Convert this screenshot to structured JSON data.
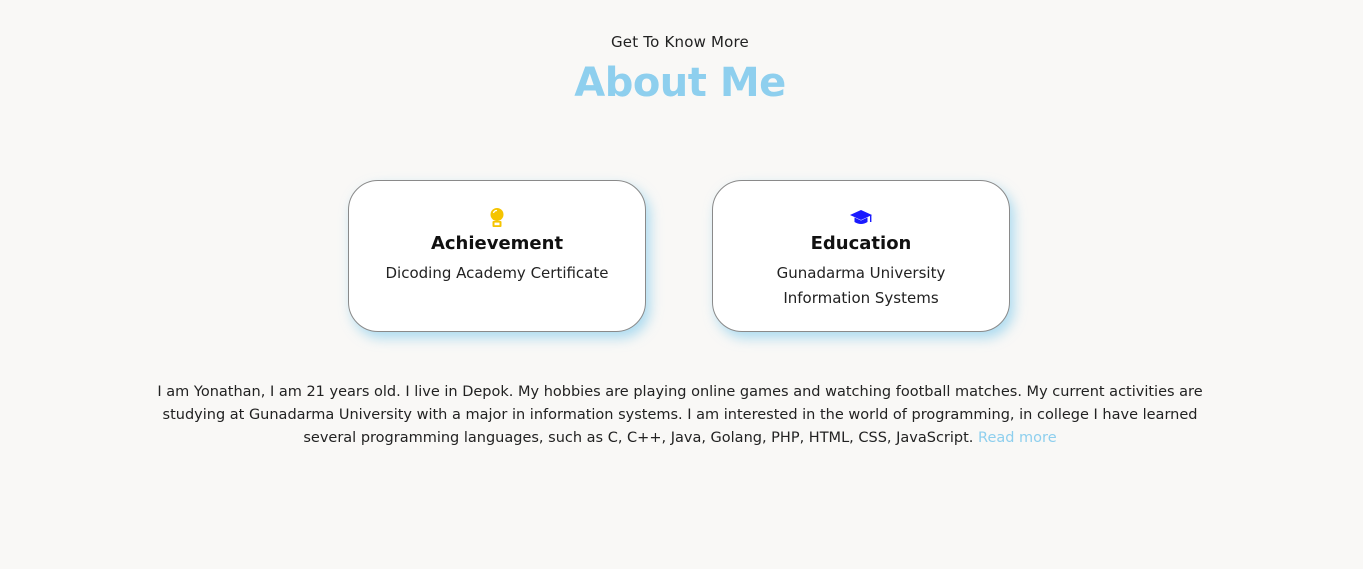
{
  "header": {
    "subtitle": "Get To Know More",
    "title": "About Me"
  },
  "cards": [
    {
      "icon": "medal-icon",
      "icon_color": "#f5c400",
      "title": "Achievement",
      "lines": [
        "Dicoding Academy Certificate"
      ]
    },
    {
      "icon": "graduation-cap-icon",
      "icon_color": "#1a1aff",
      "title": "Education",
      "lines": [
        "Gunadarma University",
        "Information Systems"
      ]
    }
  ],
  "bio": {
    "text": "I am Yonathan, I am 21 years old. I live in Depok. My hobbies are playing online games and watching football matches. My current activities are studying at Gunadarma University with a major in information systems. I am interested in the world of programming, in college I have learned several programming languages, such as C, C++, Java, Golang, PHP, HTML, CSS, JavaScript.",
    "read_more": "Read more"
  },
  "colors": {
    "accent": "#8ecfee",
    "background": "#f9f8f6"
  }
}
